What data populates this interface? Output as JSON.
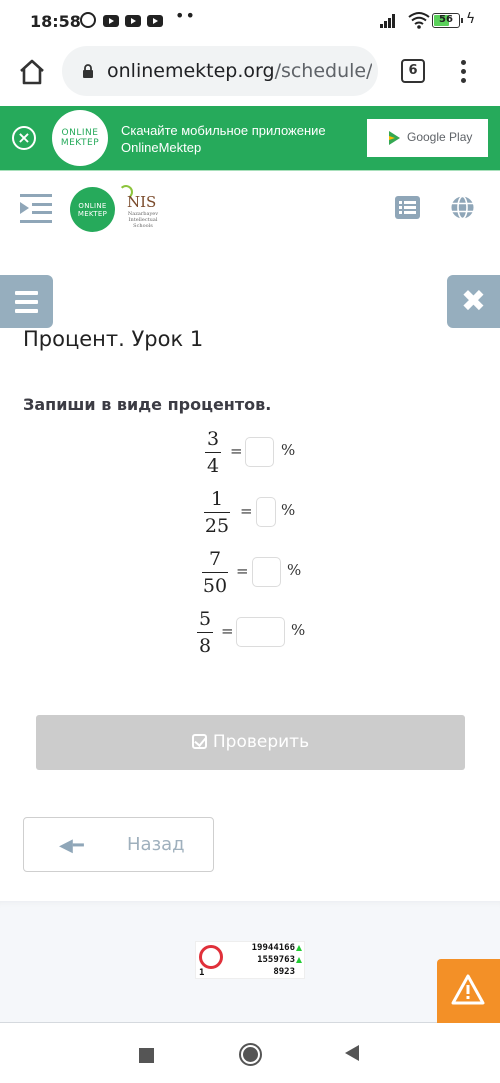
{
  "status_bar": {
    "time": "18:58",
    "notification_icons": [
      "alarm-icon",
      "youtube-icon",
      "youtube-icon",
      "youtube-icon"
    ],
    "overflow": "••",
    "battery_level": "56",
    "battery_percent": 56,
    "charging": true
  },
  "browser": {
    "url_host": "onlinemektep.org",
    "url_path": "/schedule/(",
    "tab_count": "6"
  },
  "banner": {
    "close_icon": "×",
    "logo_line1": "ONLINE",
    "logo_line2": "MEKTEP",
    "text_line1": "Скачайте мобильное приложение",
    "text_line2": "OnlineMektep",
    "store_button": "Google Play"
  },
  "header": {
    "logo_line1": "ONLINE",
    "logo_line2": "MEKTEP",
    "partner_logo": "NIS",
    "partner_sub": "Nazarbayev Intellectual Schools"
  },
  "tools": {
    "close_glyph": "✖"
  },
  "lesson": {
    "title": "Процент. Урок 1",
    "prompt": "Запиши в виде процентов.",
    "equals": "=",
    "percent": "%",
    "items": [
      {
        "numerator": "3",
        "denominator": "4",
        "answer": ""
      },
      {
        "numerator": "1",
        "denominator": "25",
        "answer": ""
      },
      {
        "numerator": "7",
        "denominator": "50",
        "answer": ""
      },
      {
        "numerator": "5",
        "denominator": "8",
        "answer": ""
      }
    ],
    "check_button": "Проверить",
    "back_button": "Назад",
    "back_arrow": "🡐"
  },
  "footer": {
    "counter": {
      "rank": "1",
      "line1": "19944166",
      "line2": "1559763",
      "line3": "8923"
    }
  },
  "colors": {
    "brand_green": "#26aa5b",
    "tool_blue_gray": "#96aebe",
    "warning_orange": "#f39027",
    "check_disabled": "#cccccc"
  }
}
